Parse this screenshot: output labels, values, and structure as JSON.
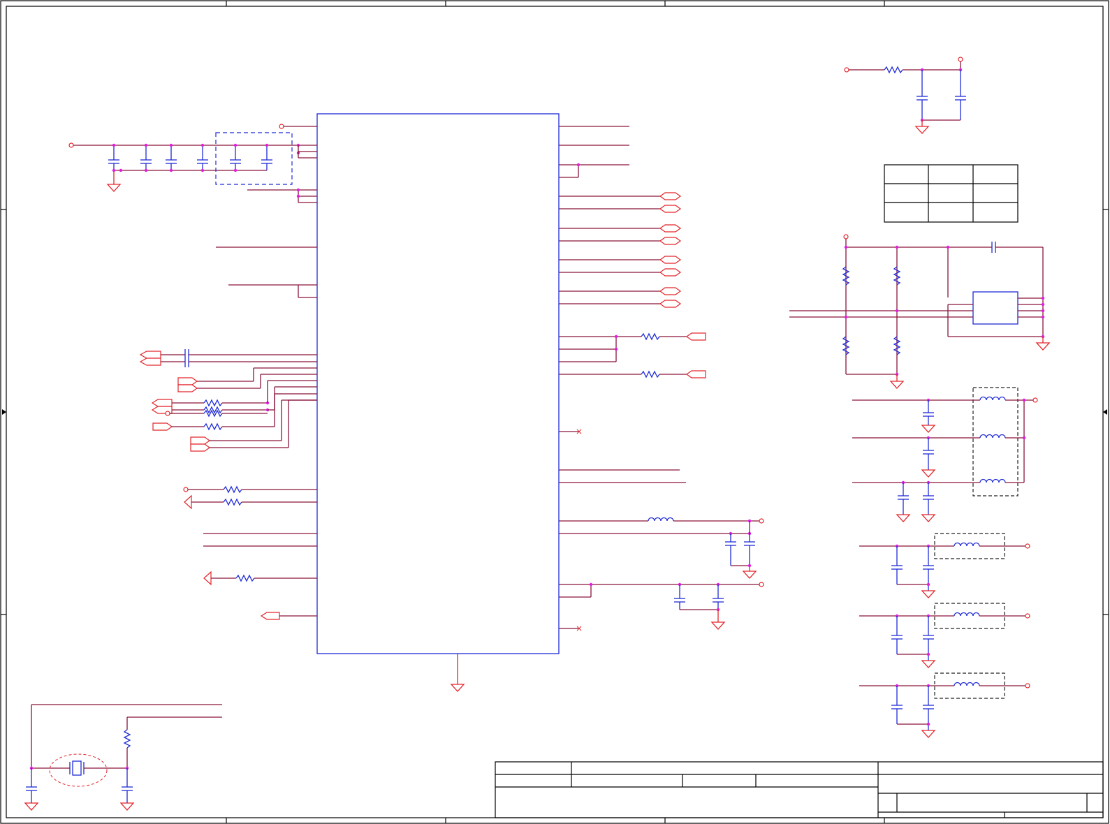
{
  "diagram": {
    "components": [
      "main-ic",
      "decoupling-capacitor-bank",
      "crystal-oscillator",
      "power-filter-network",
      "level-shifter-ic",
      "title-block"
    ]
  }
}
